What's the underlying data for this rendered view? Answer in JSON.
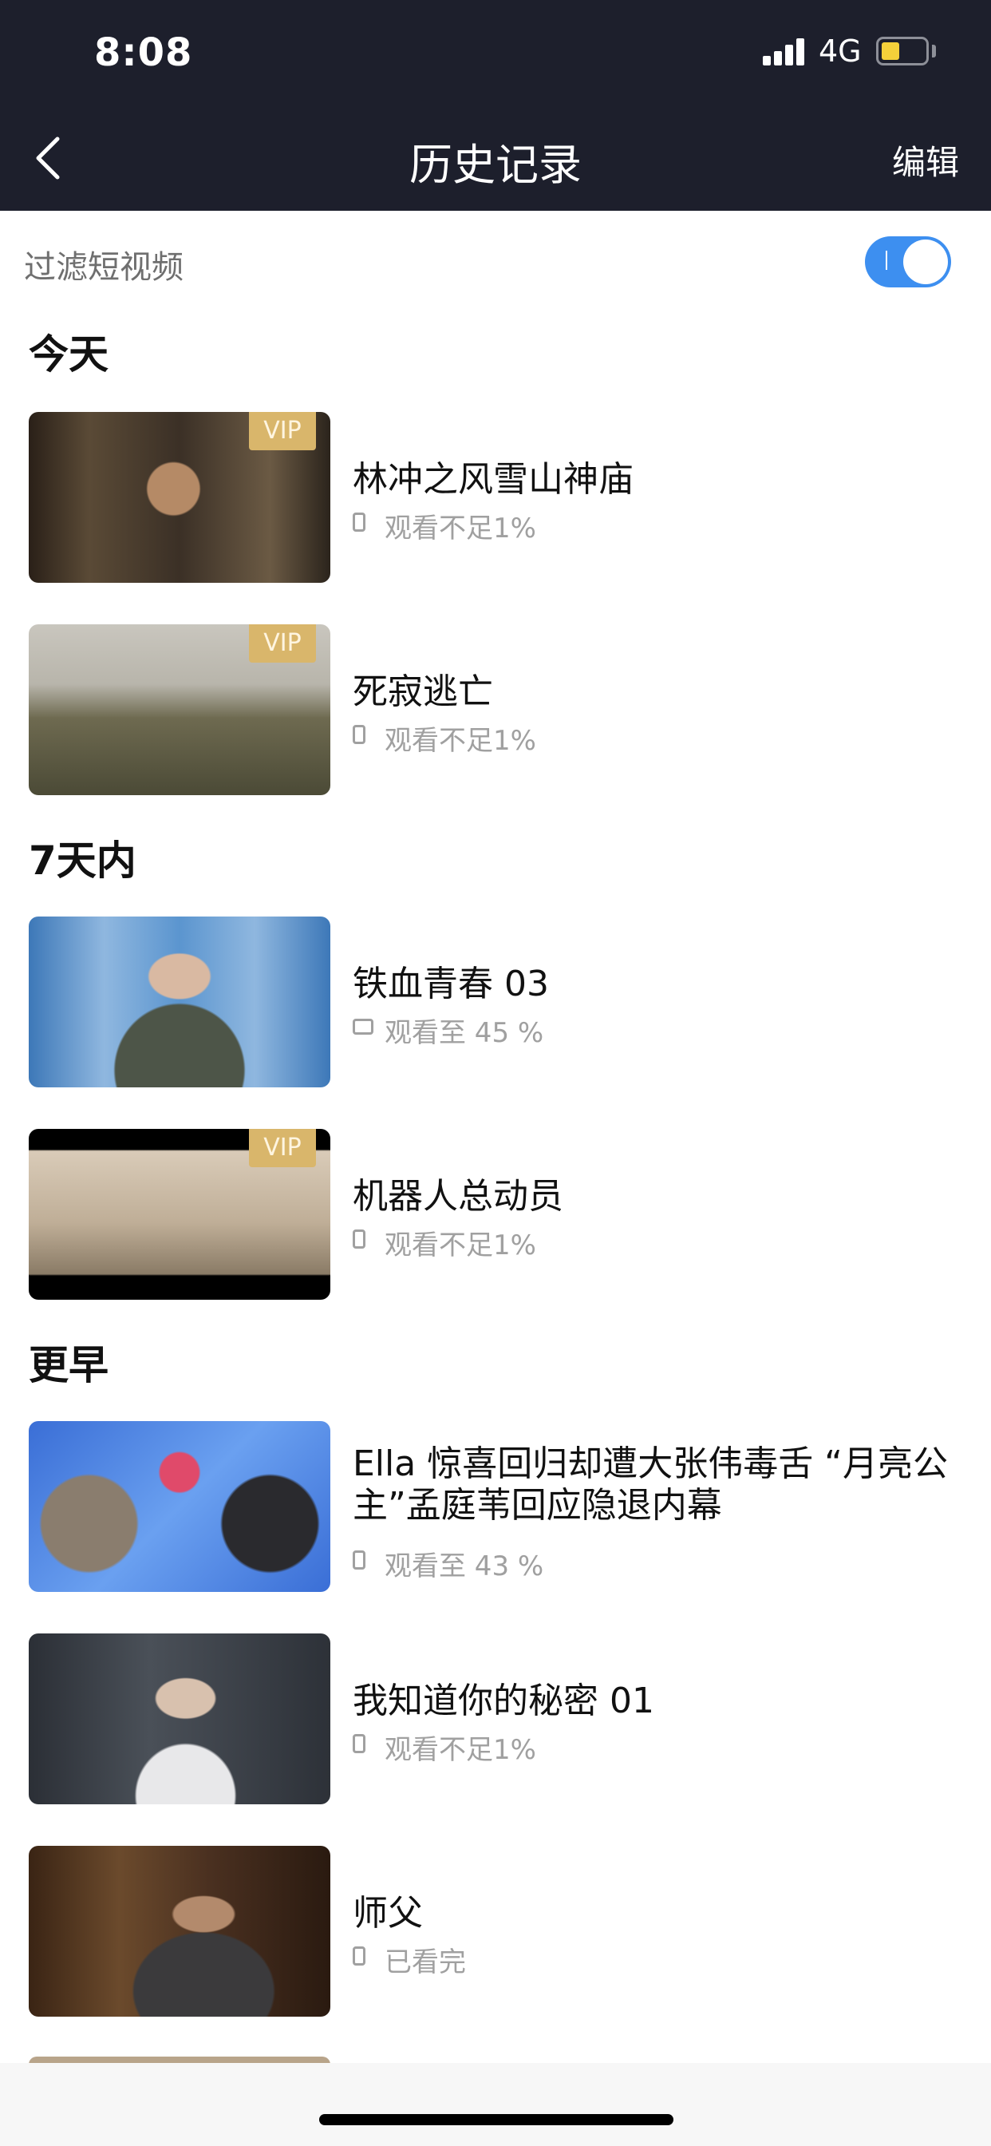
{
  "status_bar": {
    "time": "8:08",
    "network": "4G"
  },
  "nav": {
    "back_icon": "chevron-left-icon",
    "title": "历史记录",
    "edit_label": "编辑"
  },
  "filter": {
    "label": "过滤短视频",
    "enabled": true
  },
  "sections": {
    "today": "今天",
    "week": "7天内",
    "earlier": "更早"
  },
  "items": [
    {
      "title": "林冲之风雪山神庙",
      "vip": "VIP",
      "progress": "观看不足1%",
      "device_icon": "phone-icon"
    },
    {
      "title": "死寂逃亡",
      "vip": "VIP",
      "progress": "观看不足1%",
      "device_icon": "phone-icon"
    },
    {
      "title": "铁血青春 03",
      "vip": "",
      "progress": "观看至 45 %",
      "device_icon": "tv-icon"
    },
    {
      "title": "机器人总动员",
      "vip": "VIP",
      "progress": "观看不足1%",
      "device_icon": "phone-icon"
    },
    {
      "title": "Ella 惊喜回归却遭大张伟毒舌 “月亮公主”孟庭苇回应隐退内幕",
      "vip": "",
      "progress": "观看至 43 %",
      "device_icon": "phone-icon"
    },
    {
      "title": "我知道你的秘密 01",
      "vip": "",
      "progress": "观看不足1%",
      "device_icon": "phone-icon"
    },
    {
      "title": "师父",
      "vip": "",
      "progress": "已看完",
      "device_icon": "phone-icon"
    }
  ],
  "colors": {
    "header_bg": "#1d1f2c",
    "toggle_on": "#3d8ff0",
    "vip_badge": "#d9b66b"
  }
}
